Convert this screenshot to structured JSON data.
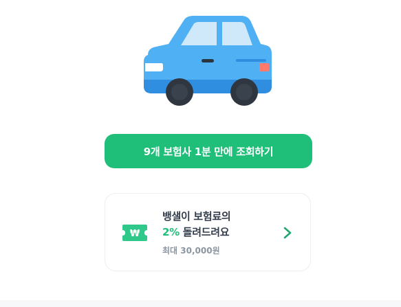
{
  "hero": {
    "illustration": "car-illustration",
    "colors": {
      "body": "#4fb0f3",
      "body_dark": "#2f8ee0",
      "window": "#cfe9fb",
      "wheel": "#2f3640",
      "headlight": "#ffffff",
      "taillight": "#ff7a6b"
    }
  },
  "cta": {
    "label": "9개 보험사 1분 만에 조회하기",
    "color": "#1fbf7a"
  },
  "promo": {
    "icon": "won-ticket-icon",
    "icon_symbol": "₩",
    "line1": "뱅샐이 보험료의",
    "percent": "2%",
    "line2_rest": " 돌려드려요",
    "note": "최대 30,000원",
    "chevron_icon": "chevron-right-icon",
    "accent_color": "#1fbf7a"
  }
}
